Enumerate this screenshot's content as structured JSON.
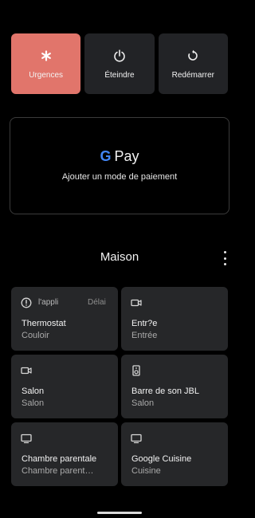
{
  "power_menu": {
    "buttons": [
      {
        "label": "Urgences",
        "icon": "emergency-asterisk-icon"
      },
      {
        "label": "Éteindre",
        "icon": "power-icon"
      },
      {
        "label": "Redémarrer",
        "icon": "restart-icon"
      }
    ]
  },
  "payment": {
    "logo_g": "G",
    "logo_pay": "Pay",
    "action": "Ajouter un mode de paiement"
  },
  "home": {
    "title": "Maison",
    "tiles": [
      {
        "title": "Thermostat",
        "subtitle": "Couloir",
        "status": "l'appli",
        "status2": "Délai",
        "icon": "alert-circle-icon"
      },
      {
        "title": "Entr?e",
        "subtitle": "Entrée",
        "icon": "camera-icon"
      },
      {
        "title": "Salon",
        "subtitle": "Salon",
        "icon": "camera-icon"
      },
      {
        "title": "Barre de son JBL",
        "subtitle": "Salon",
        "icon": "speaker-icon"
      },
      {
        "title": "Chambre parentale",
        "subtitle": "Chambre parent…",
        "icon": "tv-icon"
      },
      {
        "title": "Google Cuisine",
        "subtitle": "Cuisine",
        "icon": "tv-icon"
      }
    ]
  },
  "colors": {
    "accent": "#e1756b",
    "tile": "#262729",
    "background": "#000000"
  }
}
